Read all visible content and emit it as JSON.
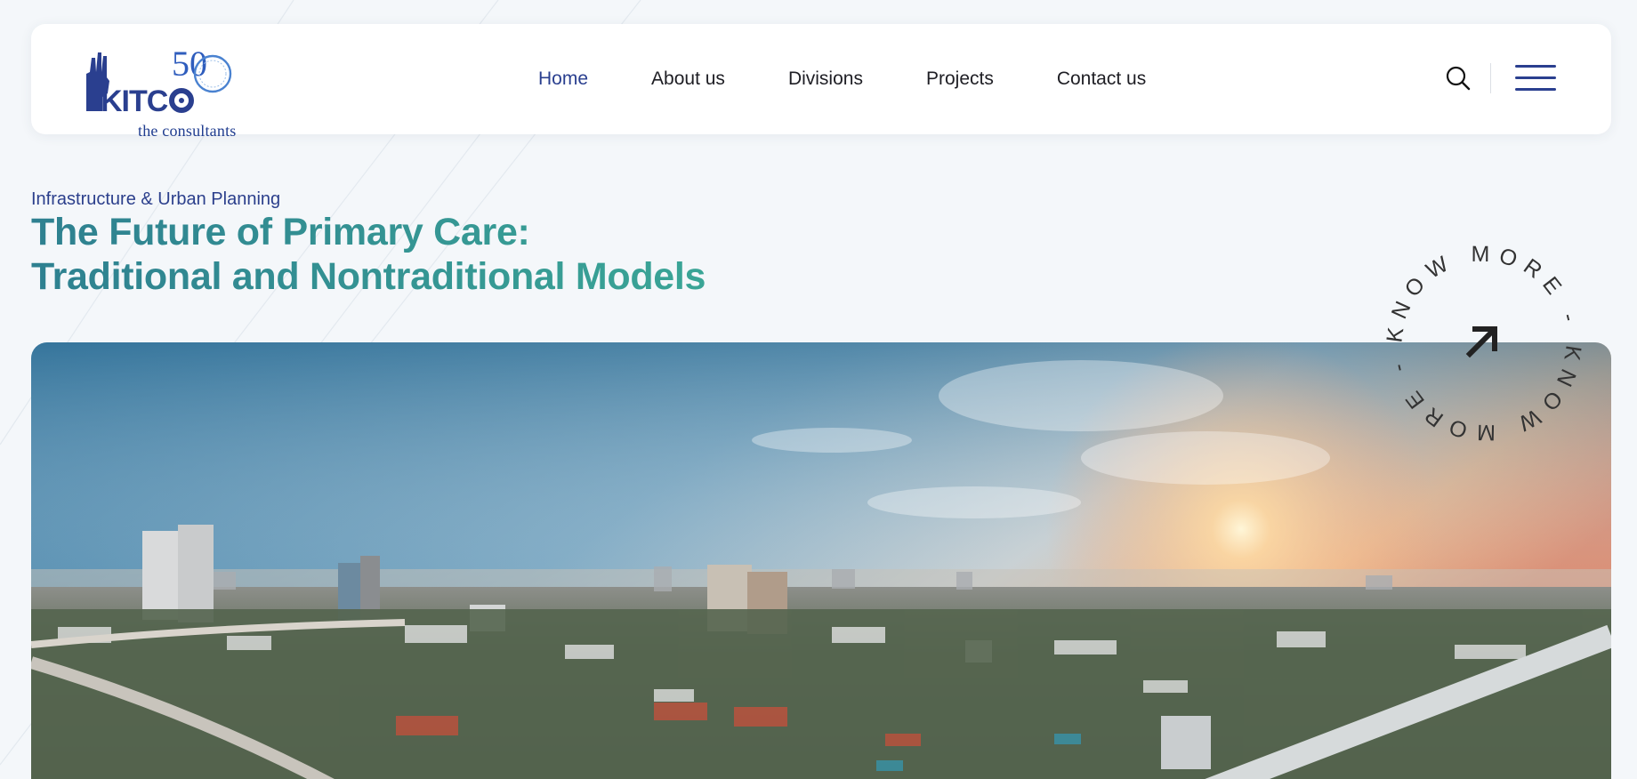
{
  "header": {
    "logo_mark": "KITCO",
    "logo_anniversary": "50",
    "logo_sub": "the consultants",
    "nav": [
      {
        "label": "Home",
        "active": true
      },
      {
        "label": "About us",
        "active": false
      },
      {
        "label": "Divisions",
        "active": false
      },
      {
        "label": "Projects",
        "active": false
      },
      {
        "label": "Contact us",
        "active": false
      }
    ],
    "search_icon": "search-icon",
    "menu_icon": "hamburger-menu-icon"
  },
  "hero": {
    "eyebrow": "Infrastructure & Urban Planning",
    "title_line1": "The Future of Primary Care:",
    "title_line2": "Traditional and Nontraditional Models",
    "know_more_text": "KNOW MORE - KNOW MORE - ",
    "know_more_icon": "arrow-up-right-icon"
  },
  "colors": {
    "brand_blue": "#2a3f8f",
    "title_teal": "#2e8d93",
    "background": "#f4f7fa"
  }
}
